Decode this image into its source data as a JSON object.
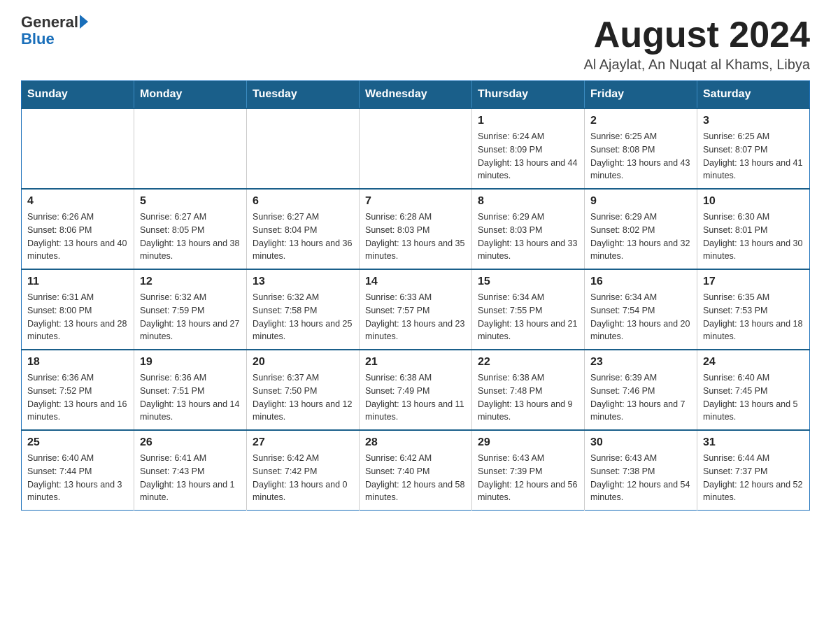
{
  "logo": {
    "text_general": "General",
    "text_blue": "Blue"
  },
  "title": "August 2024",
  "subtitle": "Al Ajaylat, An Nuqat al Khams, Libya",
  "days_of_week": [
    "Sunday",
    "Monday",
    "Tuesday",
    "Wednesday",
    "Thursday",
    "Friday",
    "Saturday"
  ],
  "weeks": [
    [
      {
        "day": "",
        "info": ""
      },
      {
        "day": "",
        "info": ""
      },
      {
        "day": "",
        "info": ""
      },
      {
        "day": "",
        "info": ""
      },
      {
        "day": "1",
        "info": "Sunrise: 6:24 AM\nSunset: 8:09 PM\nDaylight: 13 hours and 44 minutes."
      },
      {
        "day": "2",
        "info": "Sunrise: 6:25 AM\nSunset: 8:08 PM\nDaylight: 13 hours and 43 minutes."
      },
      {
        "day": "3",
        "info": "Sunrise: 6:25 AM\nSunset: 8:07 PM\nDaylight: 13 hours and 41 minutes."
      }
    ],
    [
      {
        "day": "4",
        "info": "Sunrise: 6:26 AM\nSunset: 8:06 PM\nDaylight: 13 hours and 40 minutes."
      },
      {
        "day": "5",
        "info": "Sunrise: 6:27 AM\nSunset: 8:05 PM\nDaylight: 13 hours and 38 minutes."
      },
      {
        "day": "6",
        "info": "Sunrise: 6:27 AM\nSunset: 8:04 PM\nDaylight: 13 hours and 36 minutes."
      },
      {
        "day": "7",
        "info": "Sunrise: 6:28 AM\nSunset: 8:03 PM\nDaylight: 13 hours and 35 minutes."
      },
      {
        "day": "8",
        "info": "Sunrise: 6:29 AM\nSunset: 8:03 PM\nDaylight: 13 hours and 33 minutes."
      },
      {
        "day": "9",
        "info": "Sunrise: 6:29 AM\nSunset: 8:02 PM\nDaylight: 13 hours and 32 minutes."
      },
      {
        "day": "10",
        "info": "Sunrise: 6:30 AM\nSunset: 8:01 PM\nDaylight: 13 hours and 30 minutes."
      }
    ],
    [
      {
        "day": "11",
        "info": "Sunrise: 6:31 AM\nSunset: 8:00 PM\nDaylight: 13 hours and 28 minutes."
      },
      {
        "day": "12",
        "info": "Sunrise: 6:32 AM\nSunset: 7:59 PM\nDaylight: 13 hours and 27 minutes."
      },
      {
        "day": "13",
        "info": "Sunrise: 6:32 AM\nSunset: 7:58 PM\nDaylight: 13 hours and 25 minutes."
      },
      {
        "day": "14",
        "info": "Sunrise: 6:33 AM\nSunset: 7:57 PM\nDaylight: 13 hours and 23 minutes."
      },
      {
        "day": "15",
        "info": "Sunrise: 6:34 AM\nSunset: 7:55 PM\nDaylight: 13 hours and 21 minutes."
      },
      {
        "day": "16",
        "info": "Sunrise: 6:34 AM\nSunset: 7:54 PM\nDaylight: 13 hours and 20 minutes."
      },
      {
        "day": "17",
        "info": "Sunrise: 6:35 AM\nSunset: 7:53 PM\nDaylight: 13 hours and 18 minutes."
      }
    ],
    [
      {
        "day": "18",
        "info": "Sunrise: 6:36 AM\nSunset: 7:52 PM\nDaylight: 13 hours and 16 minutes."
      },
      {
        "day": "19",
        "info": "Sunrise: 6:36 AM\nSunset: 7:51 PM\nDaylight: 13 hours and 14 minutes."
      },
      {
        "day": "20",
        "info": "Sunrise: 6:37 AM\nSunset: 7:50 PM\nDaylight: 13 hours and 12 minutes."
      },
      {
        "day": "21",
        "info": "Sunrise: 6:38 AM\nSunset: 7:49 PM\nDaylight: 13 hours and 11 minutes."
      },
      {
        "day": "22",
        "info": "Sunrise: 6:38 AM\nSunset: 7:48 PM\nDaylight: 13 hours and 9 minutes."
      },
      {
        "day": "23",
        "info": "Sunrise: 6:39 AM\nSunset: 7:46 PM\nDaylight: 13 hours and 7 minutes."
      },
      {
        "day": "24",
        "info": "Sunrise: 6:40 AM\nSunset: 7:45 PM\nDaylight: 13 hours and 5 minutes."
      }
    ],
    [
      {
        "day": "25",
        "info": "Sunrise: 6:40 AM\nSunset: 7:44 PM\nDaylight: 13 hours and 3 minutes."
      },
      {
        "day": "26",
        "info": "Sunrise: 6:41 AM\nSunset: 7:43 PM\nDaylight: 13 hours and 1 minute."
      },
      {
        "day": "27",
        "info": "Sunrise: 6:42 AM\nSunset: 7:42 PM\nDaylight: 13 hours and 0 minutes."
      },
      {
        "day": "28",
        "info": "Sunrise: 6:42 AM\nSunset: 7:40 PM\nDaylight: 12 hours and 58 minutes."
      },
      {
        "day": "29",
        "info": "Sunrise: 6:43 AM\nSunset: 7:39 PM\nDaylight: 12 hours and 56 minutes."
      },
      {
        "day": "30",
        "info": "Sunrise: 6:43 AM\nSunset: 7:38 PM\nDaylight: 12 hours and 54 minutes."
      },
      {
        "day": "31",
        "info": "Sunrise: 6:44 AM\nSunset: 7:37 PM\nDaylight: 12 hours and 52 minutes."
      }
    ]
  ]
}
